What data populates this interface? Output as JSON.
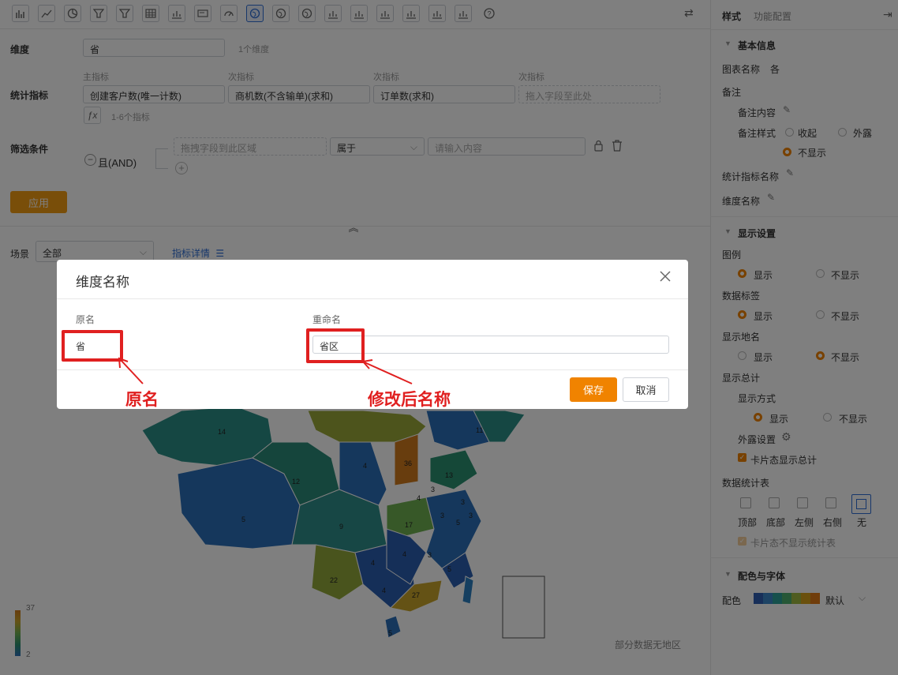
{
  "toolbar": {
    "icons": [
      "bar-chart-icon",
      "line-chart-icon",
      "pie-chart-icon",
      "funnel-icon",
      "funnel-alt-icon",
      "table-icon",
      "combo-chart-icon",
      "card-icon",
      "gauge-icon",
      "china-map-icon",
      "world-map-icon",
      "globe-icon",
      "scatter-map-icon",
      "bar-line-icon",
      "scatter-icon",
      "kpi-icon",
      "pivot-icon",
      "bubble-icon",
      "help-icon"
    ],
    "swap_icon": "swap-icon"
  },
  "config": {
    "dimension_label": "维度",
    "dimension_value": "省",
    "dimension_hint": "1个维度",
    "metric_label": "统计指标",
    "metric_headers": [
      "主指标",
      "次指标",
      "次指标",
      "次指标"
    ],
    "metrics": [
      "创建客户数(唯一计数)",
      "商机数(不含输单)(求和)",
      "订单数(求和)"
    ],
    "metric_drop_placeholder": "拖入字段至此处",
    "fx_label": "ƒx",
    "metric_hint": "1-6个指标",
    "filter_label": "筛选条件",
    "filter_logic": "且(AND)",
    "filter_drop_placeholder": "拖拽字段到此区域",
    "filter_operator": "属于",
    "filter_value_placeholder": "请输入内容",
    "apply_label": "应用"
  },
  "scene": {
    "label": "场景",
    "value": "全部",
    "detail_link": "指标详情"
  },
  "map": {
    "legend_max": "37",
    "legend_min": "2",
    "no_region_note": "部分数据无地区",
    "region_values": [
      "14",
      "12",
      "5",
      "9",
      "4",
      "17",
      "22",
      "4",
      "27",
      "5",
      "5",
      "36",
      "13",
      "11",
      "4",
      "3",
      "3",
      "4",
      "5",
      "3",
      "4",
      "3",
      "3"
    ]
  },
  "panel": {
    "tab_style": "样式",
    "tab_function": "功能配置",
    "sections": {
      "basic": "基本信息",
      "display": "显示设置",
      "color_font": "配色与字体"
    },
    "chart_name_label": "图表名称",
    "chart_name_value": "各",
    "note_label": "备注",
    "note_content_label": "备注内容",
    "note_style_label": "备注样式",
    "note_style_options": [
      "收起",
      "外露",
      "不显示"
    ],
    "metric_name_label": "统计指标名称",
    "dimension_name_label": "维度名称",
    "legend_label": "图例",
    "data_label_label": "数据标签",
    "place_name_label": "显示地名",
    "total_label": "显示总计",
    "display_mode_label": "显示方式",
    "expose_setting_label": "外露设置",
    "show_total_on_card": "卡片态显示总计",
    "stat_table_label": "数据统计表",
    "stat_table_positions": [
      "顶部",
      "底部",
      "左侧",
      "右侧",
      "无"
    ],
    "hide_stat_table_on_card": "卡片态不显示统计表",
    "opt_show": "显示",
    "opt_hide": "不显示",
    "palette_label": "配色",
    "palette_name": "默认",
    "palette_colors": [
      "#2f5fb3",
      "#3a86c8",
      "#2aa198",
      "#4caf6e",
      "#9fb840",
      "#d4a01a",
      "#e07b17"
    ]
  },
  "modal": {
    "title": "维度名称",
    "col_original": "原名",
    "col_rename": "重命名",
    "original_value": "省",
    "rename_value": "省区",
    "save_label": "保存",
    "cancel_label": "取消"
  },
  "annotations": {
    "original_note": "原名",
    "rename_note": "修改后名称"
  }
}
